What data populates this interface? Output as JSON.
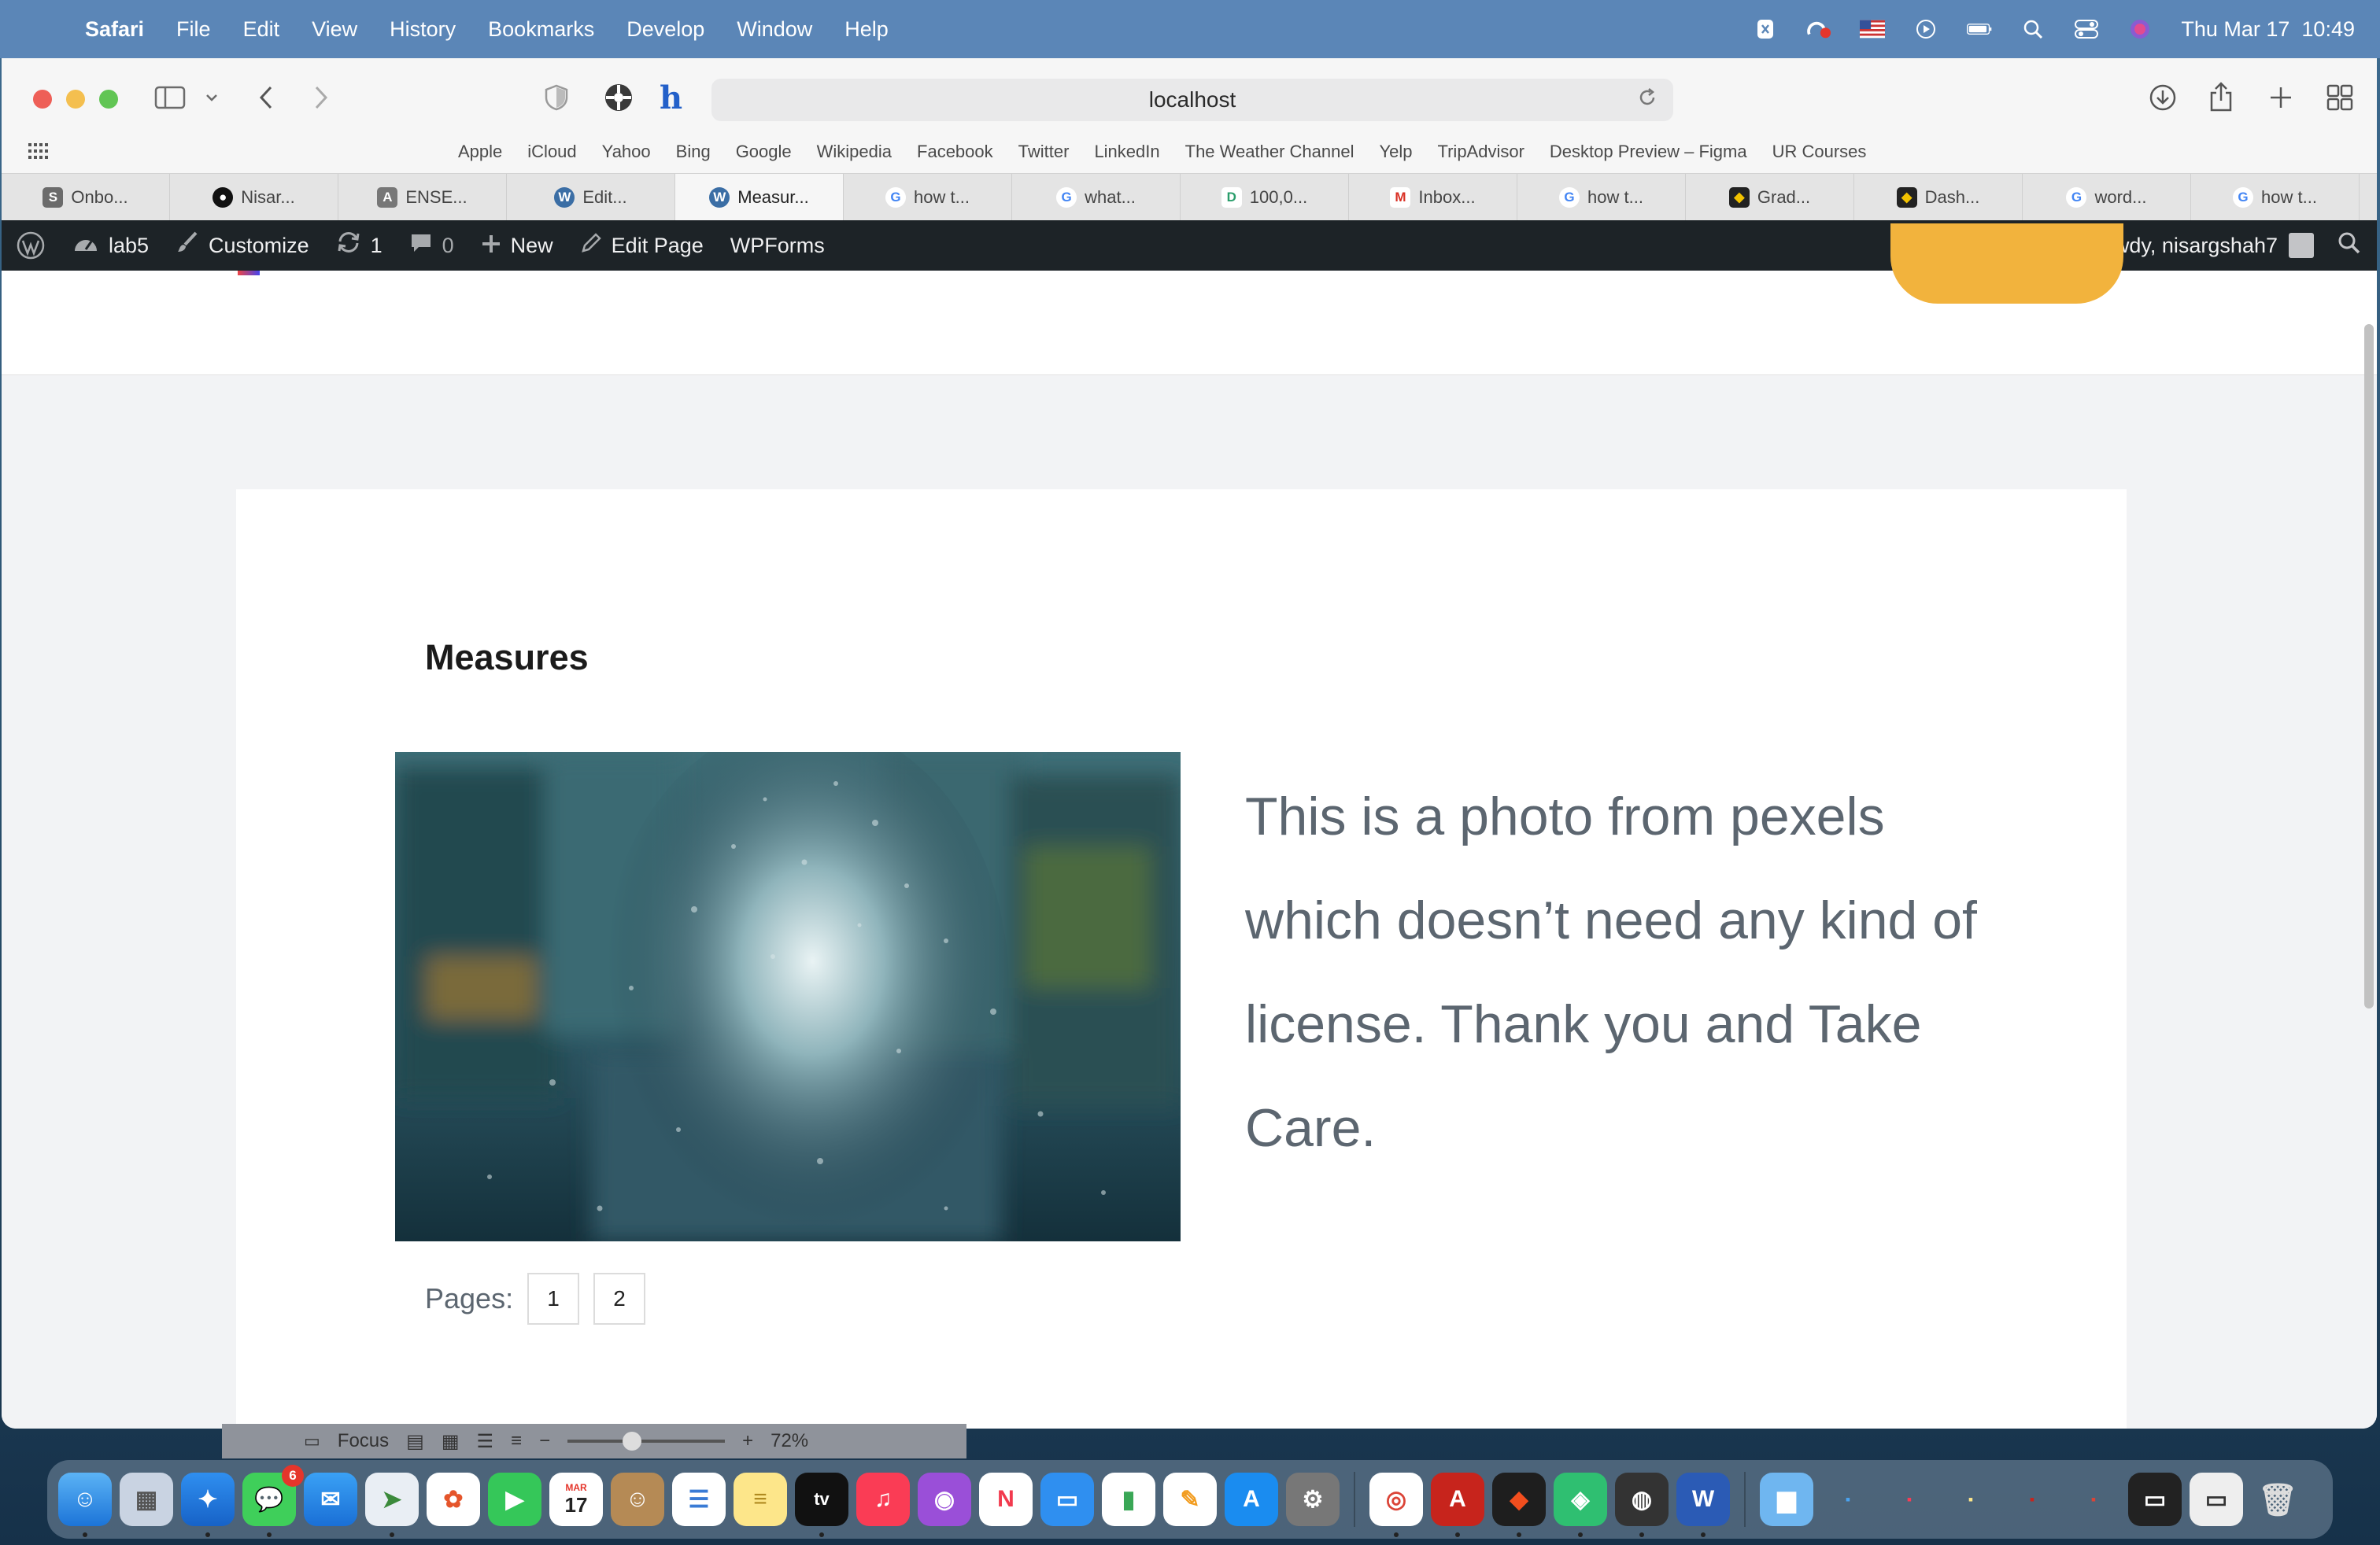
{
  "menubar": {
    "app": "Safari",
    "items": [
      "File",
      "Edit",
      "View",
      "History",
      "Bookmarks",
      "Develop",
      "Window",
      "Help"
    ],
    "datetime": "Thu Mar 17  10:49"
  },
  "browser": {
    "url": "localhost",
    "favorites": [
      "Apple",
      "iCloud",
      "Yahoo",
      "Bing",
      "Google",
      "Wikipedia",
      "Facebook",
      "Twitter",
      "LinkedIn",
      "The Weather Channel",
      "Yelp",
      "TripAdvisor",
      "Desktop Preview – Figma",
      "UR Courses"
    ],
    "tabs": [
      {
        "label": "Onbo...",
        "icon": "S",
        "color": "#6b6b6b"
      },
      {
        "label": "Nisar...",
        "icon": "github",
        "color": "#111"
      },
      {
        "label": "ENSE...",
        "icon": "A",
        "color": "#777"
      },
      {
        "label": "Edit...",
        "icon": "W",
        "color": "#3b6ea5"
      },
      {
        "label": "Measur...",
        "icon": "W",
        "color": "#3b6ea5"
      },
      {
        "label": "how t...",
        "icon": "G",
        "color": "#4285f4"
      },
      {
        "label": "what...",
        "icon": "G",
        "color": "#4285f4"
      },
      {
        "label": "100,0...",
        "icon": "D",
        "color": "#2a9d6b"
      },
      {
        "label": "Inbox...",
        "icon": "M",
        "color": "#d93025"
      },
      {
        "label": "how t...",
        "icon": "G",
        "color": "#4285f4"
      },
      {
        "label": "Grad...",
        "icon": "shield",
        "color": "#222"
      },
      {
        "label": "Dash...",
        "icon": "shield",
        "color": "#222"
      },
      {
        "label": "word...",
        "icon": "G",
        "color": "#4285f4"
      },
      {
        "label": "how t...",
        "icon": "G",
        "color": "#4285f4"
      }
    ]
  },
  "wpbar": {
    "site": "lab5",
    "customize": "Customize",
    "updates": "1",
    "comments": "0",
    "new": "New",
    "edit": "Edit Page",
    "wpforms": "WPForms",
    "howdy": "Howdy, nisargshah7"
  },
  "content": {
    "title": "Measures",
    "body": "This is a photo from pexels which doesn’t need any kind of license. Thank you and Take Care.",
    "pages_label": "Pages:",
    "pages": [
      "1",
      "2"
    ]
  },
  "wordbar": {
    "focus": "Focus",
    "zoom": "72%"
  },
  "dock": {
    "messages_badge": "6",
    "calendar_month": "MAR",
    "calendar_day": "17",
    "tv_label": "tv"
  }
}
